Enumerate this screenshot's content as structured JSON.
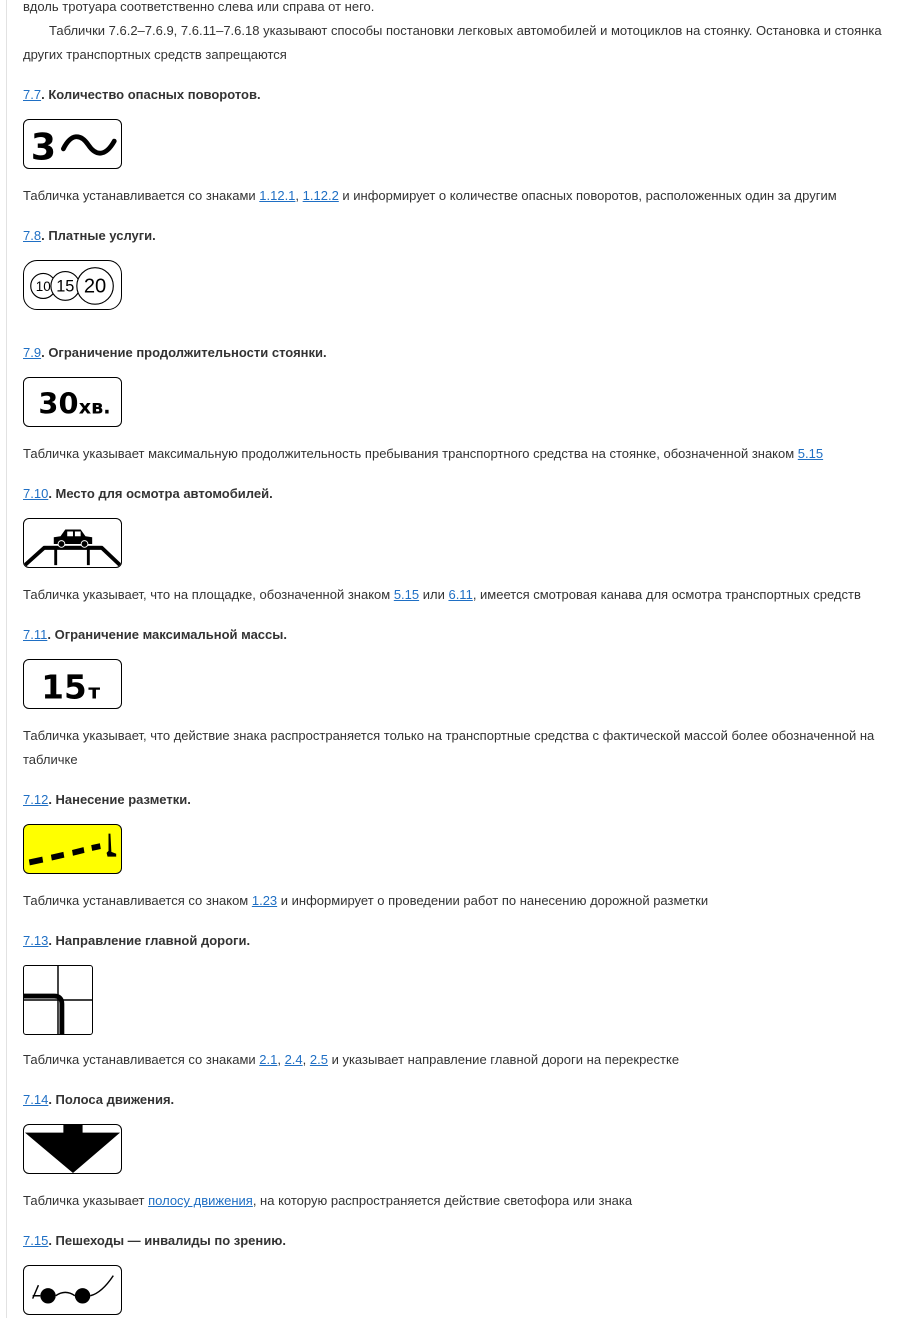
{
  "intro": {
    "line0": "вдоль тротуара соответственно слева или справа от него.",
    "para": "Таблички 7.6.2–7.6.9, 7.6.11–7.6.18 указывают способы постановки легковых автомобилей и мотоциклов на стоянку. Остановка и стоянка других транспортных средств запрещаются"
  },
  "items": [
    {
      "code": "7.7",
      "title": "Количество опасных поворотов.",
      "sign": {
        "text": "3",
        "icon": "wavy-line-icon"
      },
      "desc": {
        "p1": "Табличка устанавливается со знаками ",
        "l1": "1.12.1",
        "s1": ", ",
        "l2": "1.12.2",
        "p2": " и информирует о количестве опасных поворотов, расположенных один за другим"
      }
    },
    {
      "code": "7.8",
      "title": "Платные услуги.",
      "sign": {
        "c1": "10",
        "c2": "15",
        "c3": "20"
      }
    },
    {
      "code": "7.9",
      "title": "Ограничение продолжительности стоянки.",
      "sign": {
        "num": "30",
        "unit": "хв."
      },
      "desc": {
        "p1": "Табличка указывает максимальную продолжительность пребывания транспортного средства на стоянке, обозначенной знаком ",
        "l1": "5.15"
      }
    },
    {
      "code": "7.10",
      "title": "Место для осмотра автомобилей.",
      "sign": {
        "icon": "car-on-ramp-icon"
      },
      "desc": {
        "p1": "Табличка указывает, что на площадке, обозначенной знаком ",
        "l1": "5.15",
        "s1": " или ",
        "l2": "6.11",
        "p2": ", имеется смотровая канава для осмотра транспортных средств"
      }
    },
    {
      "code": "7.11",
      "title": "Ограничение максимальной массы.",
      "sign": {
        "num": "15",
        "unit": "т"
      },
      "desc": {
        "text": "Табличка указывает, что действие знака распространяется только на транспортные средства с фактической массой более обозначенной на табличке"
      }
    },
    {
      "code": "7.12",
      "title": "Нанесение разметки.",
      "sign": {
        "icon": "road-marking-icon",
        "bg": "#ffff00"
      },
      "desc": {
        "p1": "Табличка устанавливается со знаком ",
        "l1": "1.23",
        "p2": " и информирует о проведении работ по нанесению дорожной разметки"
      }
    },
    {
      "code": "7.13",
      "title": "Направление главной дороги.",
      "sign": {
        "icon": "main-road-direction-icon"
      },
      "desc": {
        "p1": "Табличка устанавливается со знаками ",
        "l1": "2.1",
        "s1": ", ",
        "l2": "2.4",
        "s2": ", ",
        "l3": "2.5",
        "p2": " и указывает направление главной дороги на перекрестке"
      }
    },
    {
      "code": "7.14",
      "title": "Полоса движения.",
      "sign": {
        "icon": "lane-arrow-icon"
      },
      "desc": {
        "p1": "Табличка указывает ",
        "l1": "полосу движения",
        "p2": ", на которую распространяется действие светофора или знака"
      }
    },
    {
      "code": "7.15",
      "title": "Пешеходы — инвалиды по зрению.",
      "sign": {
        "icon": "dark-glasses-icon"
      }
    }
  ],
  "colors": {
    "link": "#1f6fc4",
    "text": "#333333",
    "marking_bg": "#ffff00"
  }
}
